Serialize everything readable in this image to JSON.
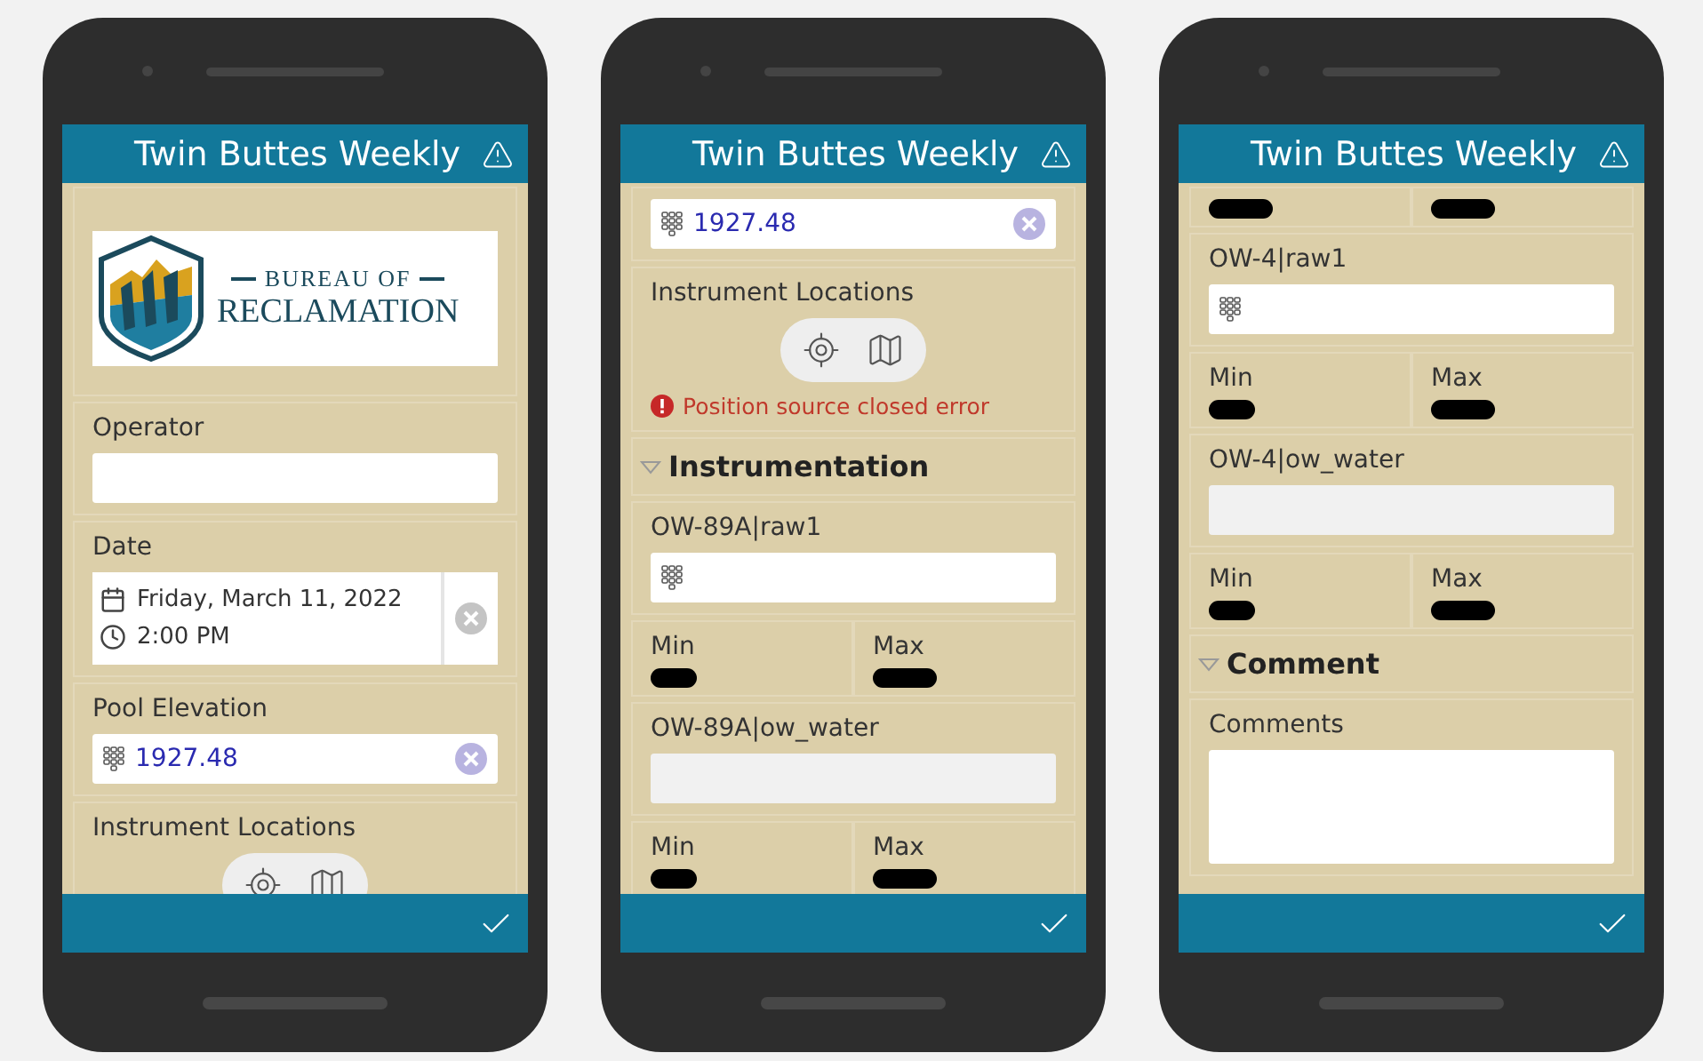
{
  "phones": [
    {
      "title": "Twin Buttes Weekly",
      "items": [
        {
          "kind": "logo",
          "line1": "BUREAU OF",
          "line2": "RECLAMATION"
        },
        {
          "kind": "text",
          "label": "Operator",
          "value": "",
          "disabled": false
        },
        {
          "kind": "date",
          "label": "Date",
          "date": "Friday, March 11, 2022",
          "time": "2:00 PM"
        },
        {
          "kind": "number",
          "label": "Pool Elevation",
          "value": "1927.48",
          "disabled": false
        },
        {
          "kind": "location",
          "label": "Instrument Locations"
        }
      ]
    },
    {
      "title": "Twin Buttes Weekly",
      "items": [
        {
          "kind": "number",
          "value": "1927.48",
          "disabled": false
        },
        {
          "kind": "location",
          "label": "Instrument Locations",
          "error": "Position source closed error"
        },
        {
          "kind": "section",
          "label": "Instrumentation"
        },
        {
          "kind": "number",
          "label": "OW-89A|raw1",
          "value": "",
          "disabled": false
        },
        {
          "kind": "minmax",
          "min": "Min",
          "max": "Max"
        },
        {
          "kind": "text",
          "label": "OW-89A|ow_water",
          "value": "",
          "disabled": true
        },
        {
          "kind": "minmax",
          "min": "Min",
          "max": "Max"
        }
      ]
    },
    {
      "title": "Twin Buttes Weekly",
      "items": [
        {
          "kind": "redacted"
        },
        {
          "kind": "number",
          "label": "OW-4|raw1",
          "value": "",
          "disabled": false
        },
        {
          "kind": "minmax",
          "min": "Min",
          "max": "Max"
        },
        {
          "kind": "text",
          "label": "OW-4|ow_water",
          "value": "",
          "disabled": true
        },
        {
          "kind": "minmax",
          "min": "Min",
          "max": "Max"
        },
        {
          "kind": "section",
          "label": "Comment"
        },
        {
          "kind": "textarea",
          "label": "Comments"
        }
      ]
    }
  ]
}
